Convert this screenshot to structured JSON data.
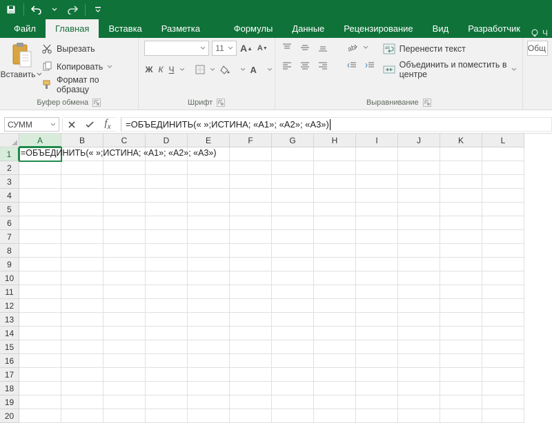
{
  "qat": {
    "save": "save",
    "undo": "undo",
    "redo": "redo"
  },
  "tabs": {
    "file": "Файл",
    "home": "Главная",
    "insert": "Вставка",
    "layout": "Разметка страницы",
    "formulas": "Формулы",
    "data": "Данные",
    "review": "Рецензирование",
    "view": "Вид",
    "developer": "Разработчик",
    "tell": "Ч"
  },
  "clipboard": {
    "paste": "Вставить",
    "cut": "Вырезать",
    "copy": "Копировать",
    "format_painter": "Формат по образцу",
    "group_label": "Буфер обмена"
  },
  "font": {
    "name_placeholder": "",
    "size": "11",
    "increase": "A",
    "decrease": "A",
    "bold": "Ж",
    "italic": "К",
    "underline": "Ч",
    "group_label": "Шрифт",
    "fill_color": "#ffff00",
    "font_color": "#d12222"
  },
  "alignment": {
    "wrap": "Перенести текст",
    "merge": "Объединить и поместить в центре",
    "group_label": "Выравнивание"
  },
  "number": {
    "placeholder": "Общ"
  },
  "formula_bar": {
    "namebox": "СУММ",
    "formula": "=ОБЪЕДИНИТЬ(« »;ИСТИНА; «A1»; «A2»; «A3»)"
  },
  "sheet": {
    "columns": [
      "A",
      "B",
      "C",
      "D",
      "E",
      "F",
      "G",
      "H",
      "I",
      "J",
      "K",
      "L"
    ],
    "rows": [
      "1",
      "2",
      "3",
      "4",
      "5",
      "6",
      "7",
      "8",
      "9",
      "10",
      "11",
      "12",
      "13",
      "14",
      "15",
      "16",
      "17",
      "18",
      "19",
      "20"
    ],
    "active_col": "A",
    "active_row": "1",
    "cell_A1": "=ОБЪЕДИНИТЬ(« »;ИСТИНА; «A1»; «A2»; «A3»)"
  }
}
